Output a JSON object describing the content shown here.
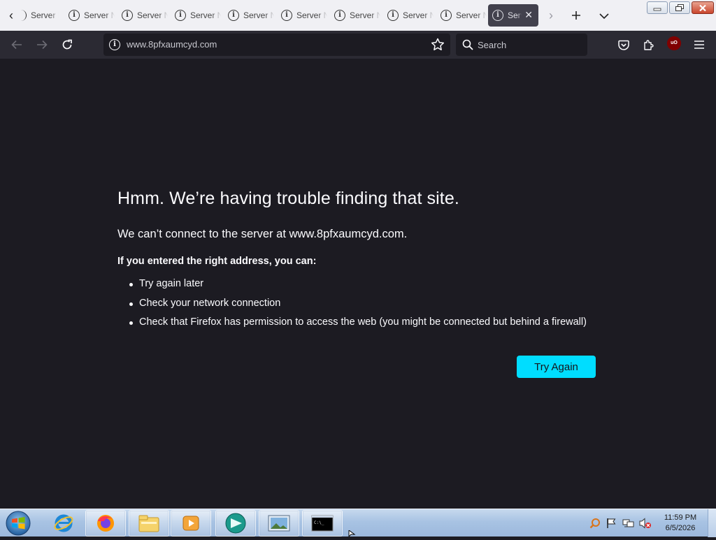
{
  "tabs": [
    {
      "title": "Server Not Found",
      "active": false
    },
    {
      "title": "Server Not Found",
      "active": false
    },
    {
      "title": "Server Not Found",
      "active": false
    },
    {
      "title": "Server Not Found",
      "active": false
    },
    {
      "title": "Server Not Found",
      "active": false
    },
    {
      "title": "Server Not Found",
      "active": false
    },
    {
      "title": "Server Not Found",
      "active": false
    },
    {
      "title": "Server Not Found",
      "active": false
    },
    {
      "title": "Server Not Found",
      "active": true
    }
  ],
  "first_tab_partial": "Server Not Found",
  "urlbar": {
    "url": "www.8pfxaumcyd.com"
  },
  "searchbar": {
    "placeholder": "Search"
  },
  "error_page": {
    "title": "Hmm. We’re having trouble finding that site.",
    "description": "We can’t connect to the server at www.8pfxaumcyd.com.",
    "hint": "If you entered the right address, you can:",
    "suggestions": [
      "Try again later",
      "Check your network connection",
      "Check that Firefox has permission to access the web (you might be connected but behind a firewall)"
    ],
    "try_again_label": "Try Again"
  },
  "taskbar": {
    "items": [
      "internet-explorer",
      "firefox",
      "file-explorer",
      "media-player",
      "vpn-app",
      "photo-viewer",
      "command-prompt"
    ],
    "clock_time": "11:59 PM",
    "clock_date": "6/5/2026"
  },
  "colors": {
    "page_bg": "#1c1b22",
    "toolbar_bg": "#2b2a33",
    "tabbar_bg": "#f0f0f4",
    "accent_button": "#00ddff"
  }
}
